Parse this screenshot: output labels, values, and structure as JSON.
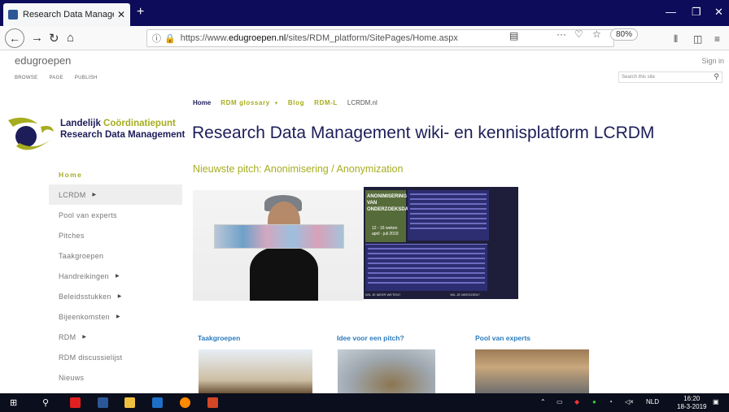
{
  "browser": {
    "tab_title": "Research Data Management w",
    "new_tab": "+",
    "url_prefix": "https://www.",
    "url_host": "edugroepen.nl",
    "url_path": "/sites/RDM_platform/SitePages/Home.aspx",
    "zoom": "80%",
    "more": "···"
  },
  "sharepoint": {
    "site_name": "edugroepen",
    "sign_in": "Sign in",
    "ribbon": [
      "BROWSE",
      "PAGE",
      "PUBLISH"
    ],
    "search_placeholder": "Search this site"
  },
  "logo": {
    "line1_a": "Landelijk ",
    "line1_b": "Coördinatiepunt",
    "line2": "Research Data Management"
  },
  "top_nav": {
    "home": "Home",
    "glossary": "RDM glossary",
    "blog": "Blog",
    "rdml": "RDM-L",
    "lcrdm": "LCRDM.nl"
  },
  "page_title": "Research Data Management wiki- en kennisplatform LCRDM",
  "pitch_title": "Nieuwste pitch: Anonimisering / Anonymization",
  "left_nav": [
    {
      "label": "Home"
    },
    {
      "label": "LCRDM"
    },
    {
      "label": "Pool van experts"
    },
    {
      "label": "Pitches"
    },
    {
      "label": "Taakgroepen"
    },
    {
      "label": "Handreikingen"
    },
    {
      "label": "Beleidsstukken"
    },
    {
      "label": "Bijeenkomsten"
    },
    {
      "label": "RDM"
    },
    {
      "label": "RDM discussielijst"
    },
    {
      "label": "Nieuws"
    }
  ],
  "poster": {
    "title1": "ANONIMISERING",
    "title2": "VAN",
    "title3": "ONDERZOEKSDATA",
    "weeks": "12 - 16 weken",
    "dates": "april - juli 2019",
    "footer_left": "WIL JE MEER WETEN?",
    "footer_right": "WIL JE MEEDOEN?"
  },
  "sections": {
    "taakgroepen": "Taakgroepen",
    "idee": "Idee voor een pitch?",
    "pool": "Pool van experts"
  },
  "taskbar": {
    "lang": "NLD",
    "time": "16:20",
    "date": "18-3-2019"
  },
  "colors": {
    "navy": "#1d1d5a",
    "olive": "#a6ad1e",
    "link_blue": "#2b7bbd"
  }
}
